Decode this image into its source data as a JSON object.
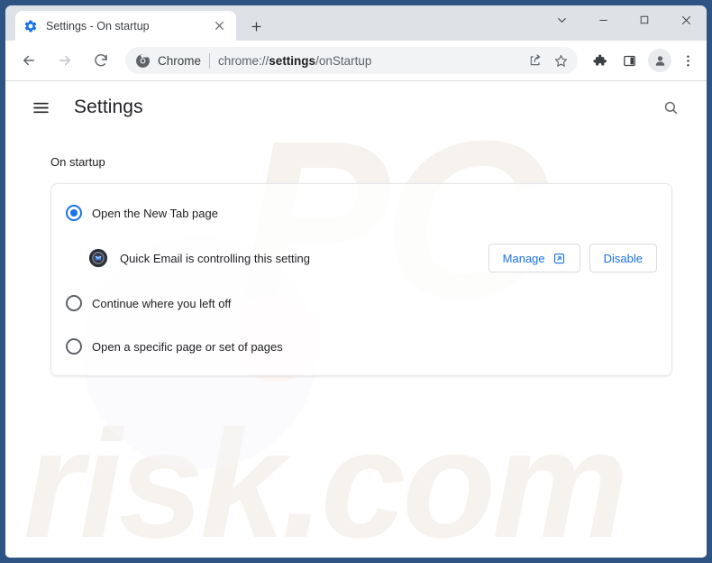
{
  "window": {
    "controls": {
      "tab_search_icon": "chevron-down-icon",
      "minimize_icon": "minimize-icon",
      "maximize_icon": "maximize-icon",
      "close_icon": "close-icon"
    }
  },
  "tabstrip": {
    "tab": {
      "title": "Settings - On startup",
      "favicon": "settings-gear-favicon",
      "close_icon": "close-icon"
    },
    "new_tab_icon": "plus-icon"
  },
  "toolbar": {
    "back_icon": "arrow-back-icon",
    "forward_icon": "arrow-forward-icon",
    "reload_icon": "reload-icon",
    "omnibox": {
      "brand_icon": "chrome-logo-icon",
      "brand_label": "Chrome",
      "url_prefix": "chrome://",
      "url_bold": "settings",
      "url_suffix": "/onStartup",
      "share_icon": "share-icon",
      "bookmark_icon": "star-icon"
    },
    "extensions_icon": "puzzle-piece-icon",
    "side_panel_icon": "side-panel-icon",
    "avatar_icon": "profile-avatar-icon",
    "menu_icon": "three-dot-menu-icon"
  },
  "settings": {
    "hamburger_icon": "hamburger-menu-icon",
    "title": "Settings",
    "search_icon": "search-icon",
    "section_title": "On startup",
    "options": [
      {
        "label": "Open the New Tab page",
        "checked": true
      },
      {
        "label": "Continue where you left off",
        "checked": false
      },
      {
        "label": "Open a specific page or set of pages",
        "checked": false
      }
    ],
    "controlled_notice": {
      "icon": "quick-email-extension-icon",
      "text": "Quick Email is controlling this setting",
      "manage_label": "Manage",
      "manage_icon": "external-link-icon",
      "disable_label": "Disable"
    }
  },
  "watermark": {
    "line1": "PC",
    "line2": "risk.com"
  },
  "colors": {
    "accent": "#1a73e8",
    "frame": "#2e5484",
    "tabstrip": "#dee1e6",
    "omnibox": "#f1f3f4",
    "text": "#202124"
  }
}
